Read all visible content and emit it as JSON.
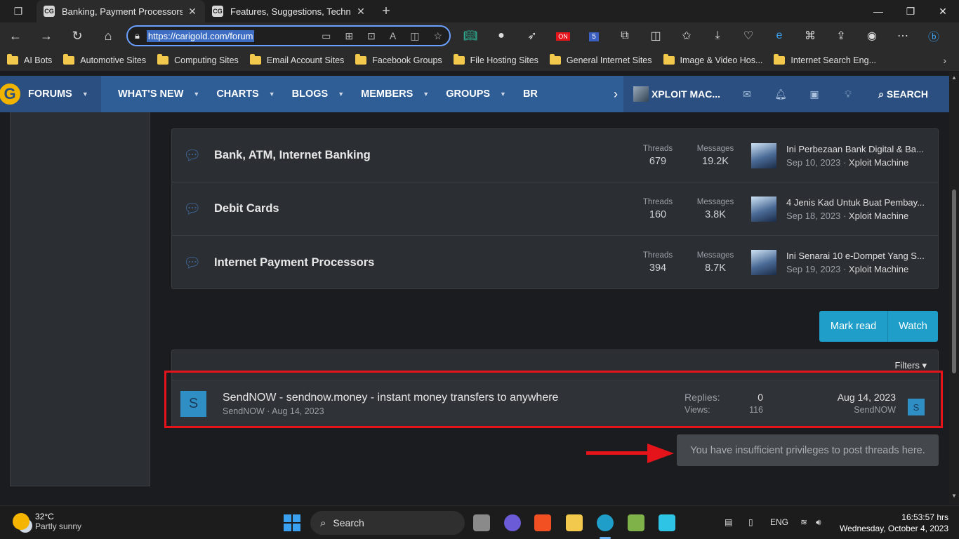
{
  "browser": {
    "tabs": [
      {
        "favicon": "CG",
        "title": "Banking, Payment Processors | Ca",
        "active": true
      },
      {
        "favicon": "CG",
        "title": "Features, Suggestions, Technical",
        "active": false
      }
    ],
    "url": "https://carigold.com/forum",
    "favorites": [
      "AI Bots",
      "Automotive Sites",
      "Computing Sites",
      "Email Account Sites",
      "Facebook Groups",
      "File Hosting Sites",
      "General Internet Sites",
      "Image & Video Hos...",
      "Internet Search Eng..."
    ],
    "ext_badge_on": "ON",
    "ext_badge_count": "5"
  },
  "forum_nav": {
    "logo_letter": "G",
    "items": [
      "FORUMS",
      "WHAT'S NEW",
      "CHARTS",
      "BLOGS",
      "MEMBERS",
      "GROUPS",
      "BR"
    ],
    "username": "XPLOIT MAC...",
    "search_label": "SEARCH"
  },
  "nodes": [
    {
      "title": "Bank, ATM, Internet Banking",
      "threads_label": "Threads",
      "threads": "679",
      "messages_label": "Messages",
      "messages": "19.2K",
      "last_title": "Ini Perbezaan Bank Digital & Ba...",
      "last_date": "Sep 10, 2023",
      "last_user": "Xploit Machine"
    },
    {
      "title": "Debit Cards",
      "threads_label": "Threads",
      "threads": "160",
      "messages_label": "Messages",
      "messages": "3.8K",
      "last_title": "4 Jenis Kad Untuk Buat Pembay...",
      "last_date": "Sep 18, 2023",
      "last_user": "Xploit Machine"
    },
    {
      "title": "Internet Payment Processors",
      "threads_label": "Threads",
      "threads": "394",
      "messages_label": "Messages",
      "messages": "8.7K",
      "last_title": "Ini Senarai 10 e-Dompet Yang S...",
      "last_date": "Sep 19, 2023",
      "last_user": "Xploit Machine"
    }
  ],
  "actions": {
    "mark_read": "Mark read",
    "watch": "Watch"
  },
  "threadlist": {
    "filters_label": "Filters",
    "thread": {
      "avatar_letter": "S",
      "title": "SendNOW - sendnow.money - instant money transfers to anywhere",
      "meta": "SendNOW · Aug 14, 2023",
      "replies_label": "Replies:",
      "replies": "0",
      "views_label": "Views:",
      "views": "116",
      "last_date": "Aug 14, 2023",
      "last_user": "SendNOW"
    }
  },
  "notice": "You have insufficient privileges to post threads here.",
  "annotation_color": "#e5141b",
  "taskbar": {
    "temp": "32°C",
    "weather": "Partly sunny",
    "search_label": "Search",
    "lang": "ENG",
    "time": "16:53:57 hrs",
    "date": "Wednesday, October 4, 2023"
  }
}
